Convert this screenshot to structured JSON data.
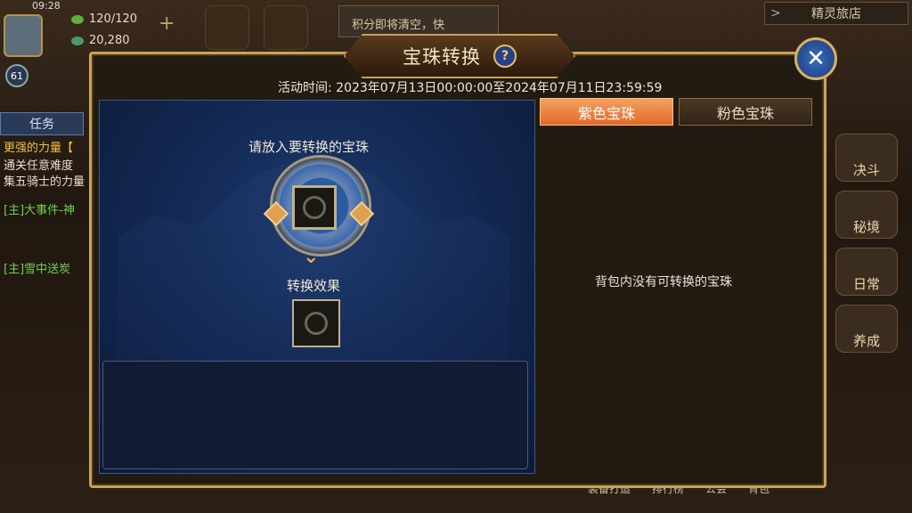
{
  "hud": {
    "time": "09:28",
    "level": "61",
    "stamina": "120/120",
    "gold": "20,280",
    "notice": "积分即将清空，快",
    "shop_tab": "精灵旅店",
    "task_tab": "任务",
    "quests": [
      {
        "text": "更强的力量【",
        "color": "#f0c040"
      },
      {
        "text": "通关任意难度",
        "color": "#e8e0c8"
      },
      {
        "text": "集五骑士的力量",
        "color": "#e8e0c8"
      },
      {
        "text": "[主]大事件-神",
        "color": "#70d050"
      },
      {
        "text": "[主]雪中送炭",
        "color": "#70d050"
      }
    ],
    "right_icons": [
      "决斗",
      "秘境",
      "日常",
      "养成"
    ],
    "bottom_items": [
      "装备打造",
      "排行榜",
      "公会",
      "背包"
    ]
  },
  "dialog": {
    "title": "宝珠转换",
    "help_icon": "question-icon",
    "close_icon": "close-icon",
    "activity_time": "活动时间: 2023年07月13日00:00:00至2024年07月11日23:59:59",
    "put_label": "请放入要转换的宝珠",
    "effect_label": "转换效果",
    "tabs": {
      "purple": "紫色宝珠",
      "pink": "粉色宝珠"
    },
    "empty_message": "背包内没有可转换的宝珠"
  },
  "colors": {
    "accent_gold": "#c8a45a",
    "active_tab": "#e06a28",
    "panel_blue": "#142a56"
  }
}
